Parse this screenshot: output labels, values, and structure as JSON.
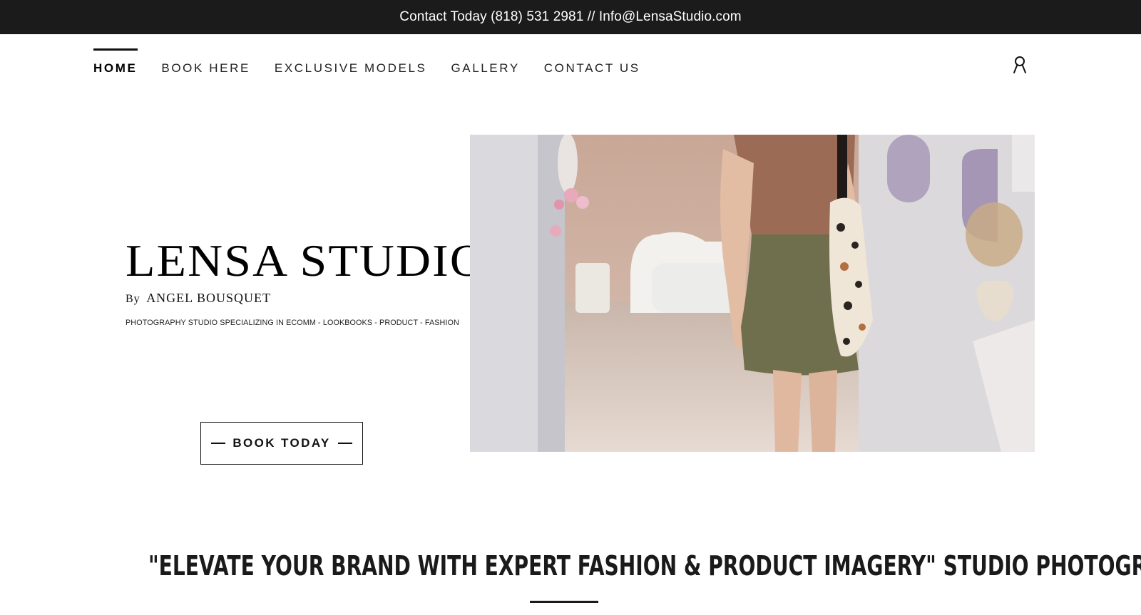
{
  "topbar": {
    "text": "Contact Today (818) 531 2981 // Info@LensaStudio.com"
  },
  "nav": {
    "items": [
      {
        "label": "HOME",
        "active": true
      },
      {
        "label": "BOOK HERE",
        "active": false
      },
      {
        "label": "EXCLUSIVE MODELS",
        "active": false
      },
      {
        "label": "GALLERY",
        "active": false
      },
      {
        "label": "CONTACT US",
        "active": false
      }
    ],
    "account_icon": "user-icon"
  },
  "brand": {
    "title": "LENSA STUDIO",
    "by": "By",
    "byline": "ANGEL BOUSQUET",
    "tagline": "PHOTOGRAPHY STUDIO SPECIALIZING IN ECOMM - LOOKBOOKS - PRODUCT - FASHION"
  },
  "cta": {
    "label": "BOOK TODAY"
  },
  "hero": {
    "image": "hero-photo"
  },
  "headline": {
    "text": "\"ELEVATE YOUR BRAND WITH EXPERT FASHION & PRODUCT IMAGERY\" STUDIO PHOTOGRAP"
  },
  "colors": {
    "topbar_bg": "#1b1b1b",
    "text": "#111111",
    "background": "#ffffff"
  }
}
